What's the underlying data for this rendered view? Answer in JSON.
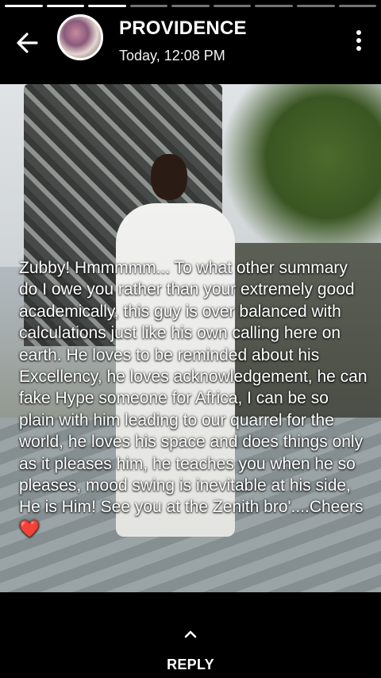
{
  "progress": {
    "total": 9,
    "seen": 3
  },
  "header": {
    "name": "PROVIDENCE",
    "time": "Today, 12:08 PM"
  },
  "story": {
    "text": "Zubby! Hmmmmm... To what other summary do I owe you rather than your extremely good academically, this guy is over balanced with calculations just like his own calling here on earth. He loves to be reminded about his Excellency, he loves acknowledgement, he can fake Hype someone for Africa, I can be so plain with him leading to our quarrel for the world, he loves his space and does things only as it pleases him, he teaches you when he so pleases, mood swing is inevitable at his side, He is Him! See you at the Zenith bro'....Cheers",
    "emoji": "❤️"
  },
  "footer": {
    "reply_label": "REPLY"
  },
  "icons": {
    "back": "arrow-left-icon",
    "menu": "more-vertical-icon",
    "reply": "chevron-up-icon"
  }
}
